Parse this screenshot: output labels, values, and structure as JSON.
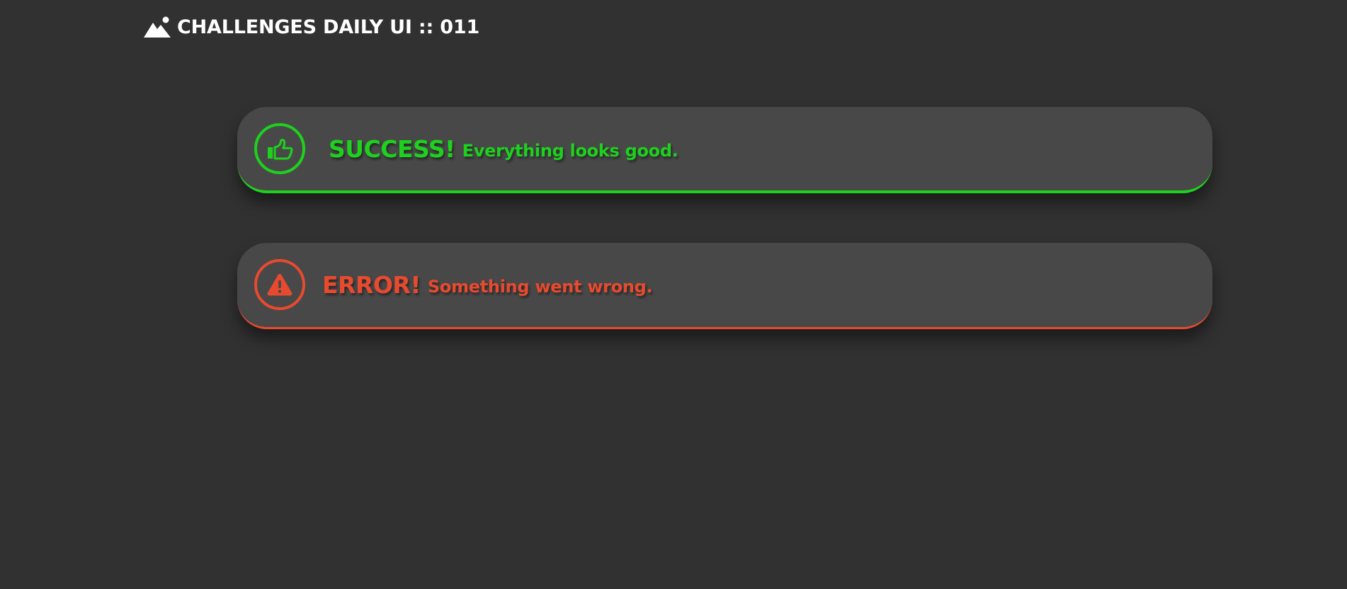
{
  "header": {
    "logo_icon": "mountain-sun-icon",
    "title": "CHALLENGES DAILY UI :: 011"
  },
  "alerts": [
    {
      "type": "success",
      "icon": "thumbs-up-icon",
      "heading": "SUCCESS!",
      "message": "Everything looks good.",
      "accent": "#1ed11e"
    },
    {
      "type": "error",
      "icon": "warning-triangle-icon",
      "heading": "ERROR!",
      "message": "Something went wrong.",
      "accent": "#e84a2f"
    }
  ],
  "colors": {
    "background": "#313131",
    "card": "#484848",
    "header_text": "#ffffff"
  }
}
